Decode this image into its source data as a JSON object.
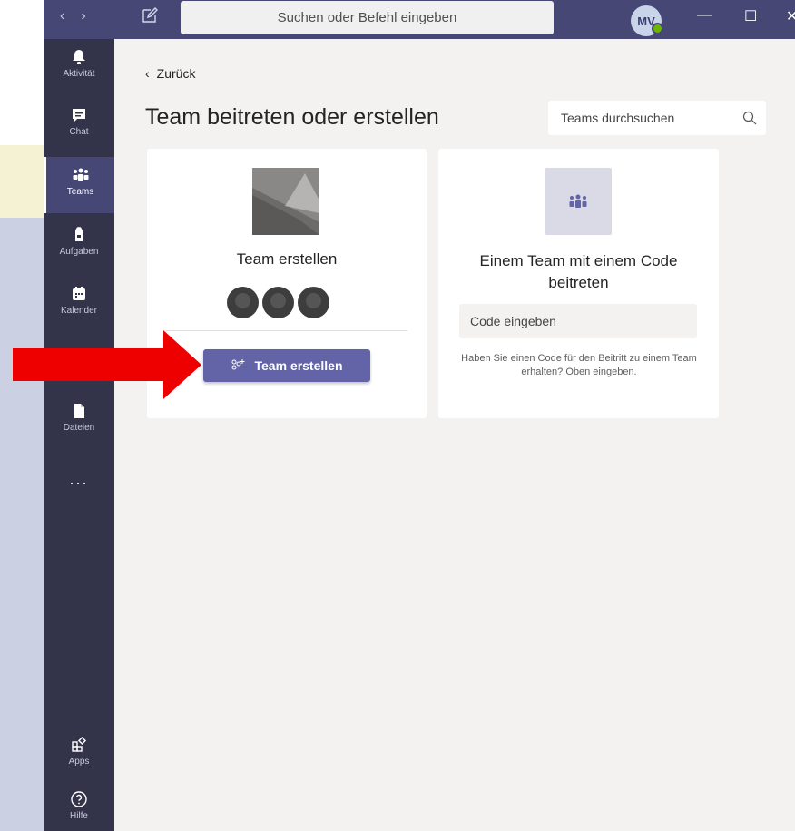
{
  "titlebar": {
    "search_placeholder": "Suchen oder Befehl eingeben",
    "avatar_initials": "MV",
    "status_color": "#6bb700"
  },
  "rail": {
    "items": [
      {
        "label": "Aktivität",
        "icon": "bell-icon"
      },
      {
        "label": "Chat",
        "icon": "chat-icon"
      },
      {
        "label": "Teams",
        "icon": "teams-icon"
      },
      {
        "label": "Aufgaben",
        "icon": "backpack-icon"
      },
      {
        "label": "Kalender",
        "icon": "calendar-icon"
      },
      {
        "label": "Dateien",
        "icon": "file-icon"
      },
      {
        "label": "Apps",
        "icon": "apps-icon"
      },
      {
        "label": "Hilfe",
        "icon": "help-icon"
      }
    ],
    "more": "..."
  },
  "main": {
    "back_label": "Zurück",
    "page_title": "Team beitreten oder erstellen",
    "team_search_placeholder": "Teams durchsuchen",
    "create_card": {
      "title": "Team erstellen",
      "button_label": "Team erstellen"
    },
    "join_card": {
      "title": "Einem Team mit einem Code beitreten",
      "code_placeholder": "Code eingeben",
      "hint": "Haben Sie einen Code für den Beitritt zu einem Team erhalten? Oben eingeben."
    }
  },
  "colors": {
    "accent": "#6264a7",
    "titlebar": "#464775",
    "rail": "#33344a",
    "annotation_arrow": "#ee0000"
  }
}
